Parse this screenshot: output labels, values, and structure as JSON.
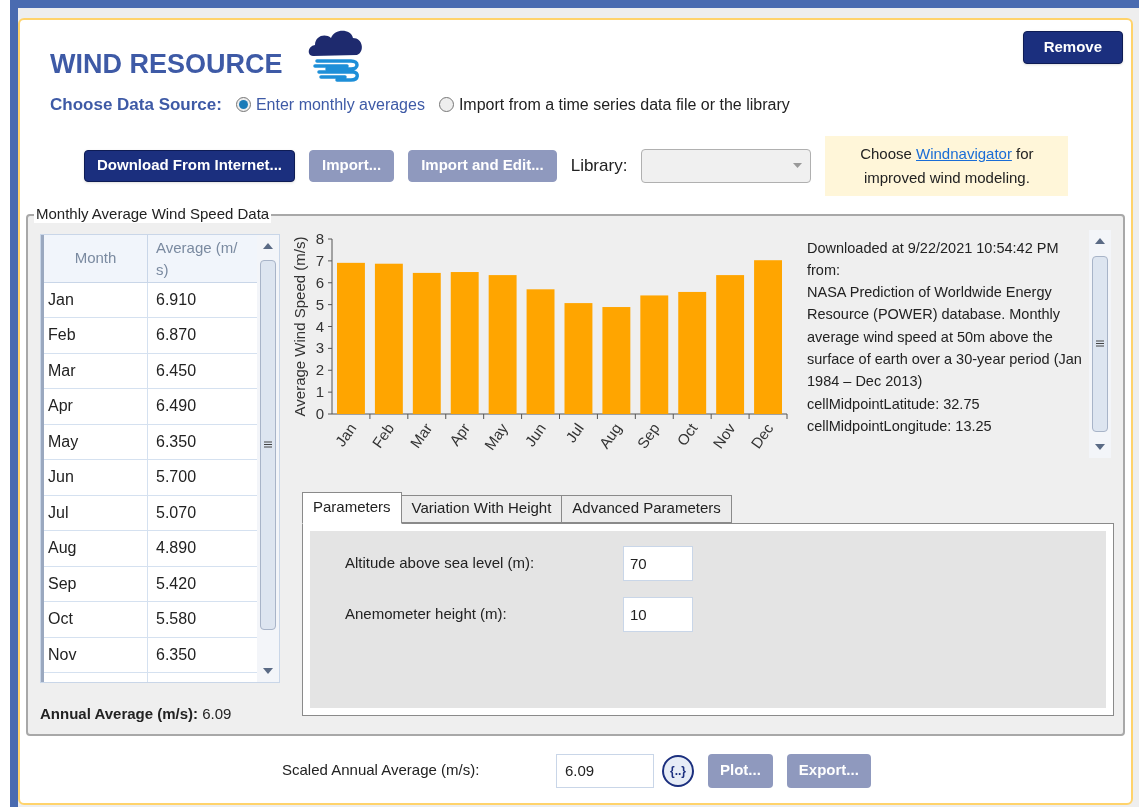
{
  "header": {
    "title": "WIND RESOURCE",
    "remove_button": "Remove"
  },
  "data_source": {
    "label": "Choose Data Source:",
    "options": [
      {
        "label": "Enter monthly averages",
        "selected": true
      },
      {
        "label": "Import from a time series data file or the library",
        "selected": false
      }
    ]
  },
  "toolbar": {
    "buttons": [
      {
        "label": "Download From Internet...",
        "disabled": false
      },
      {
        "label": "Import...",
        "disabled": true
      },
      {
        "label": "Import and Edit...",
        "disabled": true
      }
    ],
    "library_label": "Library:",
    "note": {
      "before": "Choose ",
      "link": "Windnavigator",
      "after": " for improved wind modeling."
    }
  },
  "group": {
    "title": "Monthly Average Wind Speed Data",
    "table": {
      "columns": [
        "Month",
        "Average (m/s)"
      ],
      "rows": [
        [
          "Jan",
          "6.910"
        ],
        [
          "Feb",
          "6.870"
        ],
        [
          "Mar",
          "6.450"
        ],
        [
          "Apr",
          "6.490"
        ],
        [
          "May",
          "6.350"
        ],
        [
          "Jun",
          "5.700"
        ],
        [
          "Jul",
          "5.070"
        ],
        [
          "Aug",
          "4.890"
        ],
        [
          "Sep",
          "5.420"
        ],
        [
          "Oct",
          "5.580"
        ],
        [
          "Nov",
          "6.350"
        ]
      ]
    },
    "annual_average": {
      "label": "Annual Average (m/s):",
      "value": "6.09"
    },
    "chart_data": {
      "type": "bar",
      "ylabel": "Average Wind Speed (m/s)",
      "categories": [
        "Jan",
        "Feb",
        "Mar",
        "Apr",
        "May",
        "Jun",
        "Jul",
        "Aug",
        "Sep",
        "Oct",
        "Nov",
        "Dec"
      ],
      "series": [
        {
          "color": "#ffa500",
          "values": [
            6.91,
            6.87,
            6.45,
            6.49,
            6.35,
            5.7,
            5.07,
            4.89,
            5.42,
            5.58,
            6.35,
            7.03
          ]
        }
      ],
      "ylim": [
        0,
        8
      ],
      "yticks": [
        0,
        1,
        2,
        3,
        4,
        5,
        6,
        7,
        8
      ]
    },
    "info_lines": [
      "Downloaded at 9/22/2021 10:54:42 PM from:",
      "NASA Prediction of Worldwide Energy Resource (POWER)  database. Monthly average wind speed at 50m above the surface of earth over a 30-year period (Jan 1984 – Dec 2013)",
      "cellMidpointLatitude: 32.75",
      "cellMidpointLongitude: 13.25"
    ],
    "tabs": [
      {
        "label": "Parameters",
        "selected": true
      },
      {
        "label": "Variation With Height",
        "selected": false
      },
      {
        "label": "Advanced Parameters",
        "selected": false
      }
    ],
    "parameters": [
      {
        "label": "Altitude above sea level (m):",
        "value": "70"
      },
      {
        "label": "Anemometer height (m):",
        "value": "10"
      }
    ]
  },
  "footer": {
    "label": "Scaled Annual Average (m/s):",
    "value": "6.09",
    "formula_button": "{..}",
    "buttons": [
      {
        "label": "Plot...",
        "disabled": true
      },
      {
        "label": "Export...",
        "disabled": true
      }
    ]
  }
}
